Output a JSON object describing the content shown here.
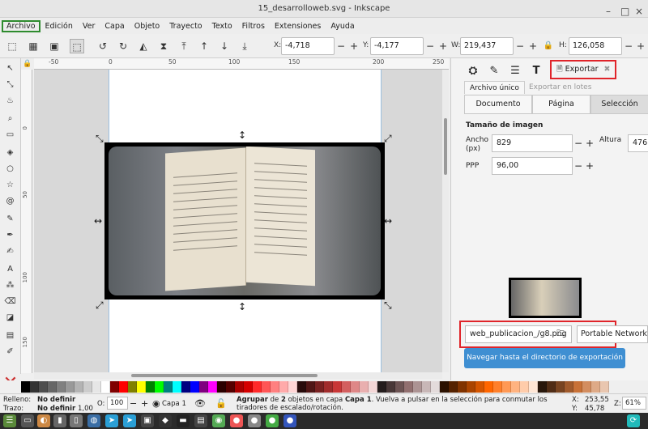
{
  "window": {
    "title": "15_desarrolloweb.svg - Inkscape",
    "min": "–",
    "max": "□",
    "close": "×"
  },
  "menu": [
    "Archivo",
    "Edición",
    "Ver",
    "Capa",
    "Objeto",
    "Trayecto",
    "Texto",
    "Filtros",
    "Extensiones",
    "Ayuda"
  ],
  "toolbar": {
    "x_label": "X:",
    "x_value": "-4,718",
    "y_label": "Y:",
    "y_value": "-4,177",
    "w_label": "W:",
    "w_value": "219,437",
    "h_label": "H:",
    "h_value": "126,058",
    "minus": "−",
    "plus": "+"
  },
  "ruler": {
    "top": [
      "-50",
      "0",
      "50",
      "100",
      "150",
      "200",
      "250"
    ],
    "left": [
      "0",
      "50",
      "100",
      "150"
    ]
  },
  "panel": {
    "export_tab": "Exportar",
    "close_x": "✖",
    "subtabs": [
      "Archivo único",
      "Exportar en lotes"
    ],
    "segments": [
      "Documento",
      "Página",
      "Selección"
    ],
    "section_title": "Tamaño de imagen",
    "ancho_label": "Ancho\n(px)",
    "ancho_value": "829",
    "altura_label": "Altura",
    "altura_value": "476",
    "ppp_label": "PPP",
    "ppp_value": "96,00",
    "filename": "web_publicacion_/g8.png",
    "format": "Portable Network Graphic",
    "nav_button": "Navegar hasta el directorio de exportación"
  },
  "palette": [
    "#000000",
    "#333333",
    "#4d4d4d",
    "#666666",
    "#808080",
    "#999999",
    "#b3b3b3",
    "#cccccc",
    "#e6e6e6",
    "#ffffff",
    "#800000",
    "#ff0000",
    "#808000",
    "#ffff00",
    "#008000",
    "#00ff00",
    "#008080",
    "#00ffff",
    "#000080",
    "#0000ff",
    "#800080",
    "#ff00ff",
    "#2b0000",
    "#550000",
    "#aa0000",
    "#d40000",
    "#ff2a2a",
    "#ff5555",
    "#ff8080",
    "#ffaaaa",
    "#ffd5d5",
    "#280b0b",
    "#501616",
    "#782121",
    "#a02c2c",
    "#c83737",
    "#d35f5f",
    "#de8787",
    "#e9afaf",
    "#f4d7d7",
    "#241c1c",
    "#483737",
    "#6c5353",
    "#916f6f",
    "#ac9393",
    "#c8b7b7",
    "#e3dbdb",
    "#2b1100",
    "#552200",
    "#803300",
    "#aa4400",
    "#d45500",
    "#ff6600",
    "#ff7f2a",
    "#ff9955",
    "#ffb380",
    "#ffccaa",
    "#ffe6d5",
    "#28170b",
    "#502d16",
    "#784421",
    "#a05a2c",
    "#c87137",
    "#d38d5f",
    "#deaa87",
    "#e9c6af"
  ],
  "status": {
    "fill_label": "Relleno:",
    "fill_value": "No definir",
    "stroke_label": "Trazo:",
    "stroke_value": "No definir",
    "stroke_width": "1,00",
    "opacity_label": "O:",
    "opacity_value": "100",
    "layer": "Capa 1",
    "message_bold1": "Agrupar",
    "message_text1": " de ",
    "message_bold2": "2",
    "message_text2": " objetos en capa ",
    "message_bold3": "Capa 1",
    "message_text3": ". Vuelva a pulsar en la selección para conmutar los tiradores de escalado/rotación.",
    "cx_label": "X:",
    "cx_value": "253,55",
    "cy_label": "Y:",
    "cy_value": "45,78",
    "zoom_label": "Z:",
    "zoom_value": "61%"
  }
}
